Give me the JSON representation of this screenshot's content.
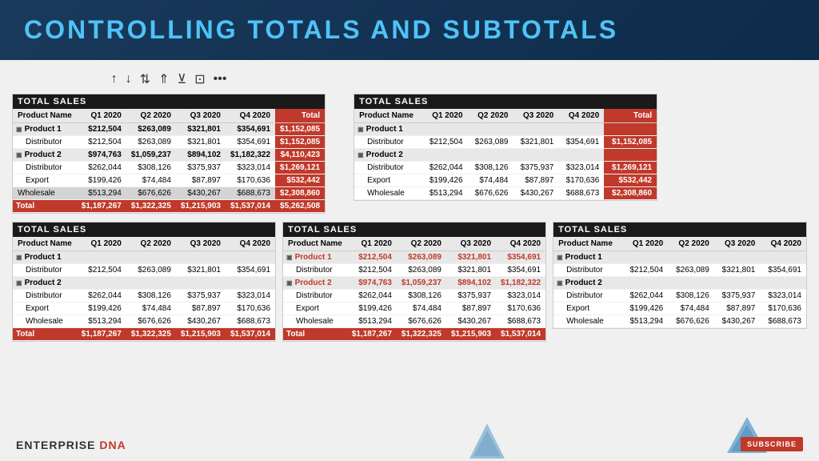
{
  "header": {
    "title": "CONTROLLING TOTALS AND SUBTOTALS"
  },
  "toolbar": {
    "icons": [
      "↑",
      "↓",
      "↕",
      "↨",
      "⊻",
      "⊡",
      "•••"
    ]
  },
  "main_table": {
    "title": "TOTAL SALES",
    "headers": [
      "Product Name",
      "Q1 2020",
      "Q2 2020",
      "Q3 2020",
      "Q4 2020",
      "Total"
    ],
    "rows": [
      {
        "type": "product",
        "name": "Product 1",
        "q1": "$212,504",
        "q2": "$263,089",
        "q3": "$321,801",
        "q4": "$354,691",
        "total": "$1,152,085"
      },
      {
        "type": "sub",
        "name": "Distributor",
        "q1": "$212,504",
        "q2": "$263,089",
        "q3": "$321,801",
        "q4": "$354,691",
        "total": "$1,152,085"
      },
      {
        "type": "product",
        "name": "Product 2",
        "q1": "$974,763",
        "q2": "$1,059,237",
        "q3": "$894,102",
        "q4": "$1,182,322",
        "total": "$4,110,423"
      },
      {
        "type": "sub",
        "name": "Distributor",
        "q1": "$262,044",
        "q2": "$308,126",
        "q3": "$375,937",
        "q4": "$323,014",
        "total": "$1,269,121"
      },
      {
        "type": "sub",
        "name": "Export",
        "q1": "$199,426",
        "q2": "$74,484",
        "q3": "$87,897",
        "q4": "$170,636",
        "total": "$532,442"
      },
      {
        "type": "highlighted",
        "name": "Wholesale",
        "q1": "$513,294",
        "q2": "$676,626",
        "q3": "$430,267",
        "q4": "$688,673",
        "total": "$2,308,860"
      },
      {
        "type": "total",
        "name": "Total",
        "q1": "$1,187,267",
        "q2": "$1,322,325",
        "q3": "$1,215,903",
        "q4": "$1,537,014",
        "total": "$5,262,508"
      }
    ]
  },
  "right_table": {
    "title": "TOTAL SALES",
    "headers": [
      "Product Name",
      "Q1 2020",
      "Q2 2020",
      "Q3 2020",
      "Q4 2020",
      "Total"
    ],
    "rows": [
      {
        "type": "product",
        "name": "Product 1",
        "q1": "",
        "q2": "",
        "q3": "",
        "q4": "",
        "total": ""
      },
      {
        "type": "sub",
        "name": "Distributor",
        "q1": "$212,504",
        "q2": "$263,089",
        "q3": "$321,801",
        "q4": "$354,691",
        "total": "$1,152,085"
      },
      {
        "type": "product",
        "name": "Product 2",
        "q1": "",
        "q2": "",
        "q3": "",
        "q4": "",
        "total": ""
      },
      {
        "type": "sub",
        "name": "Distributor",
        "q1": "$262,044",
        "q2": "$308,126",
        "q3": "$375,937",
        "q4": "$323,014",
        "total": "$1,269,121"
      },
      {
        "type": "sub",
        "name": "Export",
        "q1": "$199,426",
        "q2": "$74,484",
        "q3": "$87,897",
        "q4": "$170,636",
        "total": "$532,442"
      },
      {
        "type": "sub",
        "name": "Wholesale",
        "q1": "$513,294",
        "q2": "$676,626",
        "q3": "$430,267",
        "q4": "$688,673",
        "total": "$2,308,860"
      }
    ]
  },
  "bottom_tables": [
    {
      "title": "TOTAL SALES",
      "headers": [
        "Product Name",
        "Q1 2020",
        "Q2 2020",
        "Q3 2020",
        "Q4 2020"
      ],
      "rows": [
        {
          "type": "product",
          "name": "Product 1",
          "q1": "",
          "q2": "",
          "q3": "",
          "q4": ""
        },
        {
          "type": "sub",
          "name": "Distributor",
          "q1": "$212,504",
          "q2": "$263,089",
          "q3": "$321,801",
          "q4": "$354,691"
        },
        {
          "type": "product",
          "name": "Product 2",
          "q1": "",
          "q2": "",
          "q3": "",
          "q4": ""
        },
        {
          "type": "sub",
          "name": "Distributor",
          "q1": "$262,044",
          "q2": "$308,126",
          "q3": "$375,937",
          "q4": "$323,014"
        },
        {
          "type": "sub",
          "name": "Export",
          "q1": "$199,426",
          "q2": "$74,484",
          "q3": "$87,897",
          "q4": "$170,636"
        },
        {
          "type": "sub",
          "name": "Wholesale",
          "q1": "$513,294",
          "q2": "$676,626",
          "q3": "$430,267",
          "q4": "$688,673"
        },
        {
          "type": "total",
          "name": "Total",
          "q1": "$1,187,267",
          "q2": "$1,322,325",
          "q3": "$1,215,903",
          "q4": "$1,537,014"
        }
      ]
    },
    {
      "title": "TOTAL SALES",
      "headers": [
        "Product Name",
        "Q1 2020",
        "Q2 2020",
        "Q3 2020",
        "Q4 2020"
      ],
      "rows": [
        {
          "type": "product-orange",
          "name": "Product 1",
          "q1": "$212,504",
          "q2": "$263,089",
          "q3": "$321,801",
          "q4": "$354,691"
        },
        {
          "type": "sub",
          "name": "Distributor",
          "q1": "$212,504",
          "q2": "$263,089",
          "q3": "$321,801",
          "q4": "$354,691"
        },
        {
          "type": "product-orange",
          "name": "Product 2",
          "q1": "$974,763",
          "q2": "$1,059,237",
          "q3": "$894,102",
          "q4": "$1,182,322"
        },
        {
          "type": "sub",
          "name": "Distributor",
          "q1": "$262,044",
          "q2": "$308,126",
          "q3": "$375,937",
          "q4": "$323,014"
        },
        {
          "type": "sub",
          "name": "Export",
          "q1": "$199,426",
          "q2": "$74,484",
          "q3": "$87,897",
          "q4": "$170,636"
        },
        {
          "type": "sub",
          "name": "Wholesale",
          "q1": "$513,294",
          "q2": "$676,626",
          "q3": "$430,267",
          "q4": "$688,673"
        },
        {
          "type": "total",
          "name": "Total",
          "q1": "$1,187,267",
          "q2": "$1,322,325",
          "q3": "$1,215,903",
          "q4": "$1,537,014"
        }
      ]
    },
    {
      "title": "TOTAL SALES",
      "headers": [
        "Product Name",
        "Q1 2020",
        "Q2 2020",
        "Q3 2020",
        "Q4 2020"
      ],
      "rows": [
        {
          "type": "product",
          "name": "Product 1",
          "q1": "",
          "q2": "",
          "q3": "",
          "q4": ""
        },
        {
          "type": "sub",
          "name": "Distributor",
          "q1": "$212,504",
          "q2": "$263,089",
          "q3": "$321,801",
          "q4": "$354,691"
        },
        {
          "type": "product",
          "name": "Product 2",
          "q1": "",
          "q2": "",
          "q3": "",
          "q4": ""
        },
        {
          "type": "sub",
          "name": "Distributor",
          "q1": "$262,044",
          "q2": "$308,126",
          "q3": "$375,937",
          "q4": "$323,014"
        },
        {
          "type": "sub",
          "name": "Export",
          "q1": "$199,426",
          "q2": "$74,484",
          "q3": "$87,897",
          "q4": "$170,636"
        },
        {
          "type": "sub",
          "name": "Wholesale",
          "q1": "$513,294",
          "q2": "$676,626",
          "q3": "$430,267",
          "q4": "$688,673"
        }
      ]
    }
  ],
  "footer": {
    "brand": "ENTERPRISE DNA",
    "subscribe": "SUBSCRIBE"
  }
}
